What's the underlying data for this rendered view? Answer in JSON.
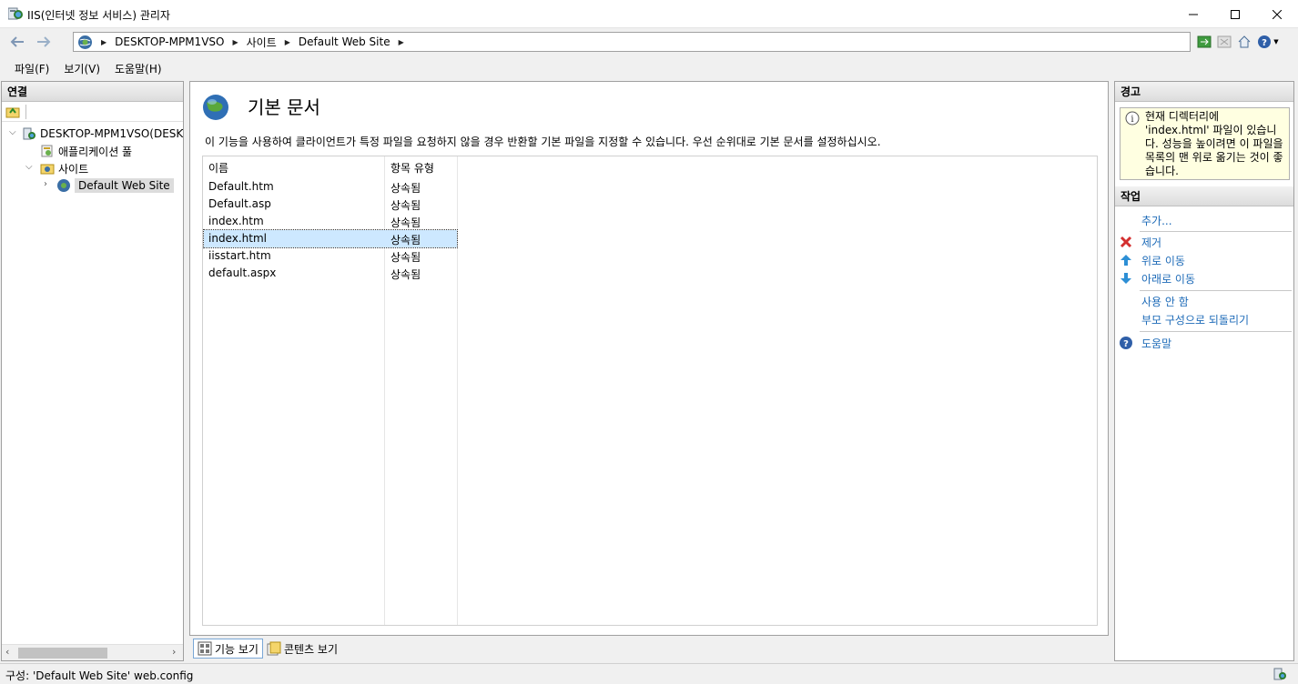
{
  "window": {
    "title": "IIS(인터넷 정보 서비스) 관리자"
  },
  "address": {
    "crumbs": [
      "DESKTOP-MPM1VSO",
      "사이트",
      "Default Web Site"
    ]
  },
  "menu": [
    "파일(F)",
    "보기(V)",
    "도움말(H)"
  ],
  "connections": {
    "title": "연결",
    "tree": [
      {
        "label": "DESKTOP-MPM1VSO(DESKT",
        "expanded": true
      },
      {
        "label": "애플리케이션 풀"
      },
      {
        "label": "사이트",
        "expanded": true
      },
      {
        "label": "Default Web Site",
        "selected": true
      }
    ]
  },
  "page": {
    "title": "기본 문서",
    "description": "이 기능을 사용하여 클라이언트가 특정 파일을 요청하지 않을 경우 반환할 기본 파일을 지정할 수 있습니다. 우선 순위대로 기본 문서를 설정하십시오.",
    "columns": [
      "이름",
      "항목 유형"
    ],
    "rows": [
      {
        "name": "Default.htm",
        "type": "상속됨"
      },
      {
        "name": "Default.asp",
        "type": "상속됨"
      },
      {
        "name": "index.htm",
        "type": "상속됨"
      },
      {
        "name": "index.html",
        "type": "상속됨",
        "selected": true
      },
      {
        "name": "iisstart.htm",
        "type": "상속됨"
      },
      {
        "name": "default.aspx",
        "type": "상속됨"
      }
    ]
  },
  "view_tabs": [
    "기능 보기",
    "콘텐츠 보기"
  ],
  "alerts": {
    "title": "경고",
    "message": "현재 디렉터리에 'index.html' 파일이 있습니다. 성능을 높이려면 이 파일을 목록의 맨 위로 옮기는 것이 좋습니다."
  },
  "actions": {
    "title": "작업",
    "items": {
      "add": "추가...",
      "remove": "제거",
      "move_up": "위로 이동",
      "move_down": "아래로 이동",
      "disable": "사용 안 함",
      "revert": "부모 구성으로 되돌리기",
      "help": "도움말"
    }
  },
  "status": {
    "text": "구성: 'Default Web Site' web.config"
  },
  "colors": {
    "link": "#1e6bb8",
    "selection": "#cde8ff",
    "alert_bg": "#ffffe1"
  }
}
